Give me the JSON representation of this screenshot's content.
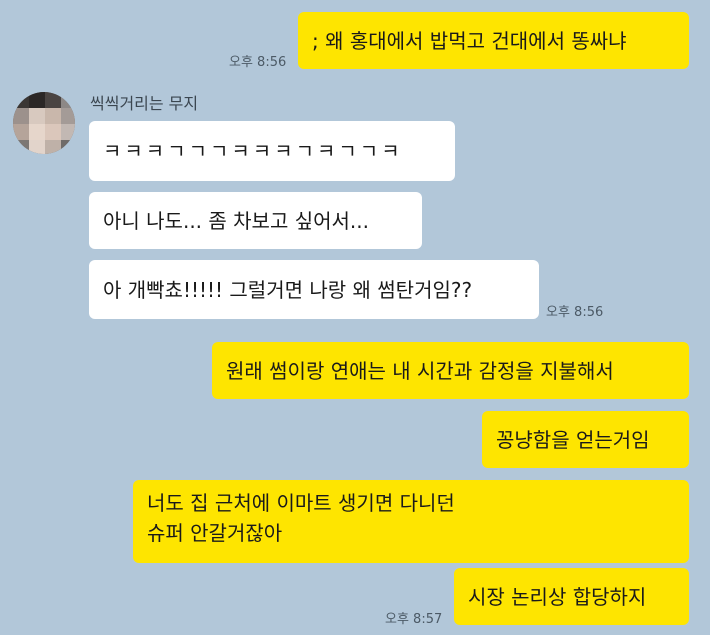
{
  "chat": {
    "sender_name": "씩씩거리는 무지",
    "messages": [
      {
        "from": "me",
        "text": "; 왜 홍대에서 밥먹고 건대에서 똥싸냐",
        "time": "오후 8:56"
      },
      {
        "from": "them",
        "text": "ㅋㅋㅋㄱㄱㄱㅋㅋㅋㄱㅋㄱㄱㅋ"
      },
      {
        "from": "them",
        "text": "아니 나도... 좀 차보고 싶어서..."
      },
      {
        "from": "them",
        "text": "아 개빡쵸!!!!! 그럴거면 나랑 왜 썸탄거임??",
        "time": "오후 8:56"
      },
      {
        "from": "me",
        "text": "원래 썸이랑 연애는 내 시간과 감정을 지불해서"
      },
      {
        "from": "me",
        "text": "꽁냥함을 얻는거임"
      },
      {
        "from": "me",
        "text": "너도 집 근처에 이마트 생기면 다니던 슈퍼 안갈거잖아"
      },
      {
        "from": "me",
        "text": "시장 논리상 합당하지",
        "time": "오후 8:57"
      }
    ]
  },
  "colors": {
    "background": "#b2c7d9",
    "my_bubble": "#fee500",
    "their_bubble": "#ffffff"
  }
}
